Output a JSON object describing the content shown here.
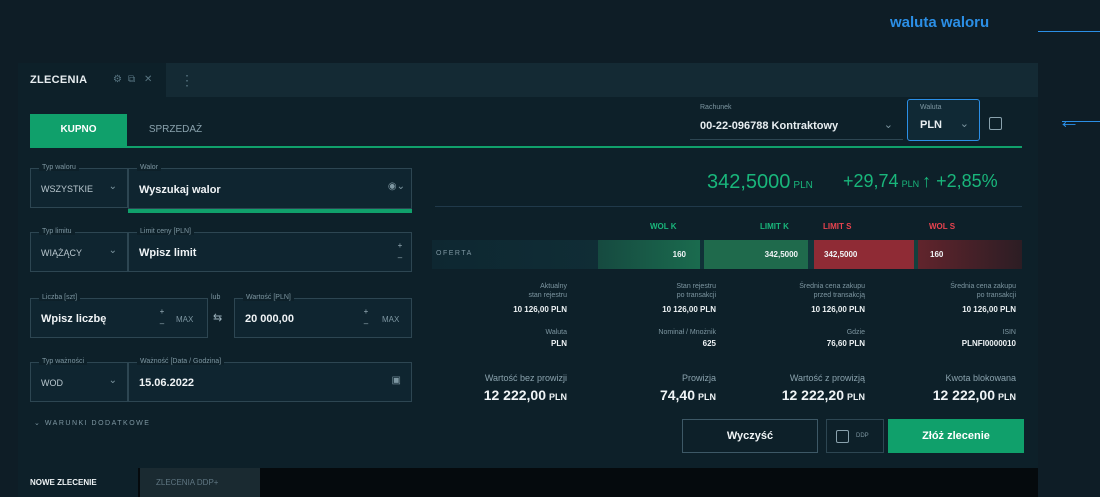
{
  "annotation": {
    "label": "waluta waloru"
  },
  "tabbar": {
    "tab_title": "ZLECENIA",
    "icons": [
      "gear-icon",
      "popout-icon",
      "close-icon",
      "add-tab-icon"
    ]
  },
  "order_side": {
    "buy_label": "KUPNO",
    "sell_label": "SPRZEDAŻ"
  },
  "account": {
    "label": "Rachunek",
    "value": "00-22-096788 Kontraktowy"
  },
  "currency": {
    "label": "Waluta",
    "value": "PLN"
  },
  "form": {
    "instrument_type": {
      "label": "Typ waloru",
      "value": "WSZYSTKIE"
    },
    "instrument": {
      "label": "Walor",
      "placeholder": "Wyszukaj walor"
    },
    "limit_type": {
      "label": "Typ limitu",
      "value": "WIĄŻĄCY"
    },
    "limit_price": {
      "label": "Limit ceny [PLN]",
      "placeholder": "Wpisz limit"
    },
    "quantity": {
      "label": "Liczba [szt]",
      "placeholder": "Wpisz liczbę",
      "max": "MAX"
    },
    "or_label": "lub",
    "value_field": {
      "label": "Wartość [PLN]",
      "value": "20 000,00",
      "max": "MAX"
    },
    "validity_type": {
      "label": "Typ ważności",
      "value": "WOD"
    },
    "validity": {
      "label": "Ważność [Data / Godzina]",
      "value": "15.06.2022"
    },
    "extra_conditions": "WARUNKI DODATKOWE"
  },
  "quote": {
    "price": "342,5000",
    "price_unit": "PLN",
    "change_abs": "+29,74",
    "change_unit": "PLN",
    "change_pct": "+2,85%",
    "colors": {
      "up": "#19b67b"
    }
  },
  "order_book": {
    "headers": {
      "bid_vol": "WOL K",
      "bid_limit": "LIMIT K",
      "ask_limit": "LIMIT S",
      "ask_vol": "WOL S"
    },
    "row_label": "OFERTA",
    "bid_vol": "160",
    "bid_limit": "342,5000",
    "ask_limit": "342,5000",
    "ask_vol": "160"
  },
  "stats": [
    {
      "label": "Aktualny\nstan rejestru",
      "value": "10 126,00 PLN"
    },
    {
      "label": "Stan rejestru\npo transakcji",
      "value": "10 126,00 PLN"
    },
    {
      "label": "Średnia cena zakupu\nprzed transakcją",
      "value": "10 126,00 PLN"
    },
    {
      "label": "Średnia cena zakupu\npo transakcji",
      "value": "10 126,00 PLN"
    },
    {
      "label": "Waluta",
      "value": "PLN"
    },
    {
      "label": "Nominał / Mnożnik",
      "value": "625"
    },
    {
      "label": "Gdzie",
      "value": "76,60 PLN"
    },
    {
      "label": "ISIN",
      "value": "PLNFI0000010"
    }
  ],
  "totals": [
    {
      "label": "Wartość bez prowizji",
      "value": "12 222,00",
      "unit": "PLN"
    },
    {
      "label": "Prowizja",
      "value": "74,40",
      "unit": "PLN"
    },
    {
      "label": "Wartość z prowizją",
      "value": "12 222,20",
      "unit": "PLN"
    },
    {
      "label": "Kwota blokowana",
      "value": "12 222,00",
      "unit": "PLN"
    }
  ],
  "actions": {
    "clear": "Wyczyść",
    "ddp": "DDP",
    "submit": "Złóż zlecenie"
  },
  "bottom_tabs": {
    "new_order": "NOWE ZLECENIE",
    "ddp_orders": "ZLECENIA DDP+"
  }
}
